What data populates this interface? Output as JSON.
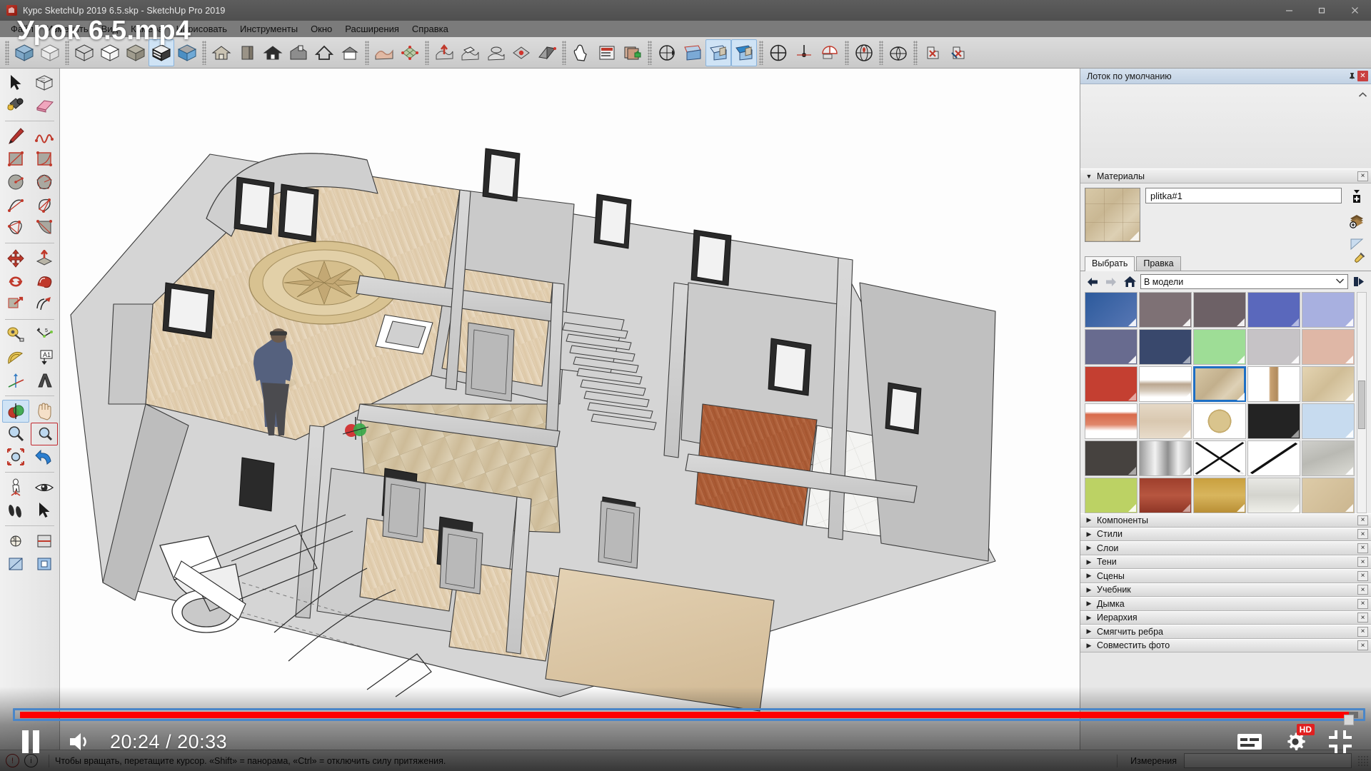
{
  "window": {
    "title": "Курс SketchUp 2019 6.5.skp - SketchUp Pro 2019",
    "app_icon": "sketchup-icon",
    "minimize": "—",
    "maximize": "❐",
    "close": "✕"
  },
  "menu": {
    "items": [
      {
        "label": "Файл"
      },
      {
        "label": "Изменить"
      },
      {
        "label": "Вид"
      },
      {
        "label": "Камера"
      },
      {
        "label": "Нарисовать"
      },
      {
        "label": "Инструменты"
      },
      {
        "label": "Окно"
      },
      {
        "label": "Расширения"
      },
      {
        "label": "Справка"
      }
    ]
  },
  "top_toolbar": {
    "groups": [
      {
        "name": "styles",
        "buttons": [
          {
            "icon": "xray-style-icon",
            "active": false
          },
          {
            "icon": "back-edges-icon",
            "active": false
          }
        ]
      },
      {
        "name": "face-styles",
        "buttons": [
          {
            "icon": "wireframe-icon",
            "active": false
          },
          {
            "icon": "hidden-line-icon",
            "active": false
          },
          {
            "icon": "shaded-icon",
            "active": false
          },
          {
            "icon": "shaded-texture-icon",
            "active": true
          },
          {
            "icon": "monochrome-icon",
            "active": false
          }
        ]
      },
      {
        "name": "views",
        "buttons": [
          {
            "icon": "iso-view-icon",
            "active": false
          },
          {
            "icon": "front-view-icon",
            "active": false
          },
          {
            "icon": "top-view-icon",
            "active": false
          },
          {
            "icon": "right-view-icon",
            "active": false
          },
          {
            "icon": "back-view-icon",
            "active": false
          },
          {
            "icon": "left-view-icon",
            "active": false
          }
        ]
      },
      {
        "name": "sandbox",
        "buttons": [
          {
            "icon": "from-contours-icon",
            "active": false
          },
          {
            "icon": "from-scratch-icon",
            "active": false
          }
        ]
      },
      {
        "name": "sandbox-tools",
        "buttons": [
          {
            "icon": "smoove-icon",
            "active": false
          },
          {
            "icon": "stamp-icon",
            "active": false
          },
          {
            "icon": "drape-icon",
            "active": false
          },
          {
            "icon": "add-detail-icon",
            "active": false
          },
          {
            "icon": "flip-edge-icon",
            "active": false
          }
        ]
      },
      {
        "name": "dynamic",
        "buttons": [
          {
            "icon": "interact-icon",
            "active": false
          },
          {
            "icon": "component-options-icon",
            "active": false
          },
          {
            "icon": "component-attributes-icon",
            "active": false
          }
        ]
      },
      {
        "name": "walkthrough",
        "buttons": [
          {
            "icon": "position-camera-icon",
            "active": false
          },
          {
            "icon": "section-plane-icon",
            "active": false
          },
          {
            "icon": "display-section-planes-icon",
            "active": true
          },
          {
            "icon": "display-section-cuts-icon",
            "active": true
          }
        ]
      },
      {
        "name": "solar",
        "buttons": [
          {
            "icon": "solar-north-icon",
            "active": false
          },
          {
            "icon": "north-tool-icon",
            "active": false
          },
          {
            "icon": "shadow-settings-icon",
            "active": false
          }
        ]
      },
      {
        "name": "geolocation",
        "buttons": [
          {
            "icon": "add-location-icon",
            "active": false
          }
        ]
      },
      {
        "name": "warehouse",
        "buttons": [
          {
            "icon": "3d-warehouse-icon",
            "active": false
          }
        ]
      },
      {
        "name": "extensions",
        "buttons": [
          {
            "icon": "extension-red-icon",
            "active": false
          },
          {
            "icon": "extension-blue-icon",
            "active": false
          }
        ]
      }
    ]
  },
  "left_toolbar": {
    "groups": [
      {
        "name": "principal",
        "rows": [
          [
            {
              "icon": "select-arrow-icon",
              "active": false
            },
            {
              "icon": "make-component-icon",
              "active": false
            }
          ],
          [
            {
              "icon": "paint-bucket-icon",
              "active": false
            },
            {
              "icon": "eraser-icon",
              "active": false
            }
          ]
        ]
      },
      {
        "name": "drawing",
        "rows": [
          [
            {
              "icon": "line-pencil-icon",
              "active": false
            },
            {
              "icon": "freehand-icon",
              "active": false
            }
          ],
          [
            {
              "icon": "rectangle-icon",
              "active": false
            },
            {
              "icon": "rotated-rectangle-icon",
              "active": false
            }
          ],
          [
            {
              "icon": "circle-icon",
              "active": false
            },
            {
              "icon": "polygon-icon",
              "active": false
            }
          ],
          [
            {
              "icon": "arc-icon",
              "active": false
            },
            {
              "icon": "two-point-arc-icon",
              "active": false
            }
          ],
          [
            {
              "icon": "three-point-arc-icon",
              "active": false
            },
            {
              "icon": "pie-icon",
              "active": false
            }
          ]
        ]
      },
      {
        "name": "modification",
        "rows": [
          [
            {
              "icon": "move-icon",
              "active": false
            },
            {
              "icon": "pushpull-icon",
              "active": false
            }
          ],
          [
            {
              "icon": "rotate-icon",
              "active": false
            },
            {
              "icon": "followme-icon",
              "active": false
            }
          ],
          [
            {
              "icon": "scale-icon",
              "active": false
            },
            {
              "icon": "offset-icon",
              "active": false
            }
          ]
        ]
      },
      {
        "name": "construction",
        "rows": [
          [
            {
              "icon": "tape-measure-icon",
              "active": false
            },
            {
              "icon": "dimension-icon",
              "active": false
            }
          ],
          [
            {
              "icon": "protractor-icon",
              "active": false
            },
            {
              "icon": "text-label-icon",
              "active": false
            }
          ],
          [
            {
              "icon": "axes-icon",
              "active": false
            },
            {
              "icon": "3d-text-icon",
              "active": false
            }
          ]
        ]
      },
      {
        "name": "camera",
        "rows": [
          [
            {
              "icon": "orbit-icon",
              "active": true
            },
            {
              "icon": "pan-hand-icon",
              "active": false
            }
          ],
          [
            {
              "icon": "zoom-icon",
              "active": false
            },
            {
              "icon": "zoom-window-icon",
              "active": false,
              "outlined": true
            }
          ],
          [
            {
              "icon": "zoom-extents-icon",
              "active": false
            },
            {
              "icon": "previous-view-icon",
              "active": false
            }
          ]
        ]
      },
      {
        "name": "walkthrough",
        "rows": [
          [
            {
              "icon": "position-camera-person-icon",
              "active": false
            },
            {
              "icon": "look-around-eye-icon",
              "active": false
            }
          ],
          [
            {
              "icon": "walk-feet-icon",
              "active": false
            },
            {
              "icon": "section-plane-icon",
              "active": false
            }
          ]
        ]
      },
      {
        "name": "section",
        "rows": [
          [
            {
              "icon": "section-display-icon",
              "active": false
            },
            {
              "icon": "section-cut-icon",
              "active": false
            }
          ],
          [
            {
              "icon": "section-fill-icon",
              "active": false
            },
            {
              "icon": "section-toggle-icon",
              "active": false
            }
          ]
        ]
      }
    ]
  },
  "tray": {
    "title": "Лоток по умолчанию",
    "pin_icon": "pin-icon",
    "close_icon": "close-icon",
    "scroll_up_icon": "chevron-up-icon",
    "materials": {
      "title": "Материалы",
      "collapse_arrow": "▼",
      "close_label": "×",
      "preview_icon": "material-preview-swatch",
      "name": "plitka#1",
      "side_buttons": [
        {
          "icon": "create-material-icon"
        },
        {
          "icon": "sample-paint-icon"
        },
        {
          "icon": "material-details-icon"
        }
      ],
      "tabs": [
        {
          "label": "Выбрать",
          "active": true
        },
        {
          "label": "Правка",
          "active": false
        }
      ],
      "eyedropper_icon": "eyedropper-icon",
      "nav": {
        "back_icon": "arrow-left-icon",
        "forward_icon": "arrow-right-icon",
        "home_icon": "home-icon",
        "library": "В модели",
        "dropdown_icon": "chevron-down-icon",
        "details_icon": "details-arrow-icon"
      },
      "swatch_rows": [
        [
          {
            "name": "blue-gradient",
            "style": "linear-gradient(135deg,#2c5a9c,#5877b4)"
          },
          {
            "name": "warm-gray",
            "style": "#7e7175"
          },
          {
            "name": "dark-mauve",
            "style": "#6d6166"
          },
          {
            "name": "indigo-blue",
            "style": "#5a68bc"
          },
          {
            "name": "light-periwinkle",
            "style": "#a8b0e0"
          }
        ],
        [
          {
            "name": "slate-violet",
            "style": "#686b8f"
          },
          {
            "name": "navy-blue",
            "style": "#39486c"
          },
          {
            "name": "light-green",
            "style": "#9edd96"
          },
          {
            "name": "pale-gray",
            "style": "#c6c3c6"
          },
          {
            "name": "dusty-rose",
            "style": "#dfb7a6"
          }
        ],
        [
          {
            "name": "brick-red",
            "style": "#c43f31"
          },
          {
            "name": "tile-photo",
            "style": "linear-gradient(to bottom,#fff 38%,#bba790 50%,#d6cabb 70%,#fff 88%)"
          },
          {
            "name": "plitka-tile",
            "style": "linear-gradient(135deg,#d8c9a8,#c2af8c 45%,#ded1b6 70%,#c4b089)",
            "selected": true
          },
          {
            "name": "wood-plank",
            "style": "linear-gradient(to right,#fff 40%,#c8a172 43%,#b08a5c 57%,#fff 60%)"
          },
          {
            "name": "beige-stone",
            "style": "linear-gradient(135deg,#e4d4b2,#d0bd96,#e8dcc0)"
          }
        ],
        [
          {
            "name": "orange-brick",
            "style": "linear-gradient(to bottom,#fff 22%,#d86a4c 30%,#e0866a 60%,#fff 78%)"
          },
          {
            "name": "light-parquet",
            "style": "linear-gradient(to bottom,#e5d8c6,#d9c8b0,#e8dccb)"
          },
          {
            "name": "compass-medallion",
            "style": "radial-gradient(circle at 50% 50%,#d9c48d 0 34%,#c5ab6c 34% 38%,#fff 38%)"
          },
          {
            "name": "near-black",
            "style": "#232323"
          },
          {
            "name": "pale-blue-sky",
            "style": "#c7dbef"
          }
        ],
        [
          {
            "name": "charcoal",
            "style": "#46423f"
          },
          {
            "name": "brushed-metal",
            "style": "linear-gradient(to right,#9a9a9a,#f2f2f2 30%,#8f8f8f 55%,#efefef 75%,#a8a8a8)"
          },
          {
            "name": "cross-hatch",
            "style": "#ffffff"
          },
          {
            "name": "diagonal-line",
            "style": "#ffffff"
          },
          {
            "name": "stone-pavers",
            "style": "linear-gradient(160deg,#cfcfcb,#b9b9b3 45%,#dcdcd6)"
          }
        ],
        [
          {
            "name": "olive-green",
            "style": "#bcd264"
          },
          {
            "name": "dark-red-brick",
            "style": "linear-gradient(to bottom,#9e3f2c,#b75640 50%,#8f3626)"
          },
          {
            "name": "yellow-brick",
            "style": "linear-gradient(to bottom,#c9a03f,#d8b55d 50%,#b98f35)"
          },
          {
            "name": "white-brick",
            "style": "linear-gradient(to bottom,#e8e8e4,#d4d4ce 50%,#efefe9)"
          },
          {
            "name": "sandstone-tile",
            "style": "linear-gradient(135deg,#ddcba8,#cbb68f)"
          }
        ]
      ]
    },
    "panels": [
      {
        "label": "Компоненты",
        "arrow": "▶",
        "close": "×"
      },
      {
        "label": "Стили",
        "arrow": "▶",
        "close": "×"
      },
      {
        "label": "Слои",
        "arrow": "▶",
        "close": "×"
      },
      {
        "label": "Тени",
        "arrow": "▶",
        "close": "×"
      },
      {
        "label": "Сцены",
        "arrow": "▶",
        "close": "×"
      },
      {
        "label": "Учебник",
        "arrow": "▶",
        "close": "×"
      },
      {
        "label": "Дымка",
        "arrow": "▶",
        "close": "×"
      },
      {
        "label": "Иерархия",
        "arrow": "▶",
        "close": "×"
      },
      {
        "label": "Смягчить ребра",
        "arrow": "▶",
        "close": "×"
      },
      {
        "label": "Совместить фото",
        "arrow": "▶",
        "close": "×"
      }
    ]
  },
  "statusbar": {
    "warning_icon": "warning-circle-icon",
    "info_icon": "info-circle-icon",
    "hint": "Чтобы вращать, перетащите курсор. «Shift» = панорама, «Ctrl» = отключить силу притяжения.",
    "measurements_label": "Измерения",
    "measurements_value": "",
    "resize_grip_icon": "resize-grip-icon"
  },
  "video": {
    "overlay_title": "Урок 6.5.mp4",
    "play_state": "paused",
    "pause_icon": "pause-icon",
    "volume_icon": "volume-icon",
    "current_time": "20:24",
    "total_time": "20:33",
    "time_display": "20:24 / 20:33",
    "progress_percent": 99.3,
    "controls_right": [
      {
        "icon": "subtitles-icon",
        "name": "subtitles-button"
      },
      {
        "icon": "settings-gear-icon",
        "name": "settings-button",
        "badge": "HD"
      },
      {
        "icon": "exit-fullscreen-icon",
        "name": "exit-fullscreen-button"
      }
    ],
    "accent_color": "#ff0000",
    "selection_outline_color": "#4a86c8"
  },
  "viewport": {
    "model_name": "floor-plan-3d-model",
    "description": "SketchUp 3D architectural floor plan with walls, windows, stairs, wood and tile floors, scale figure and axis origin"
  }
}
